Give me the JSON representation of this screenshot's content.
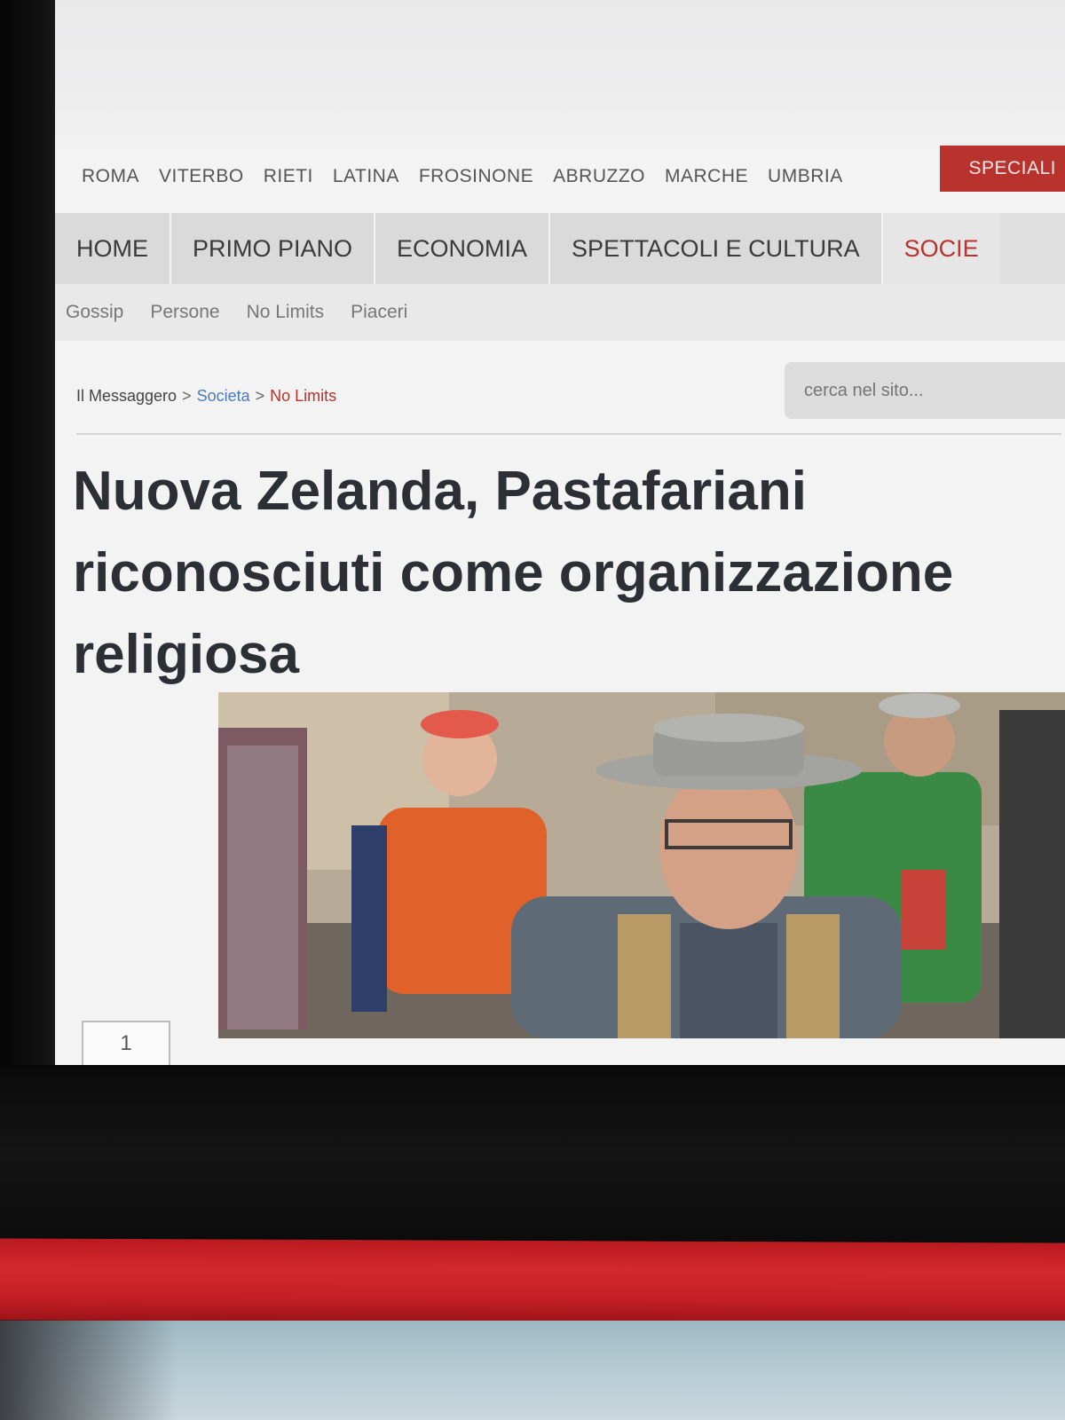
{
  "regions": [
    "ROMA",
    "VITERBO",
    "RIETI",
    "LATINA",
    "FROSINONE",
    "ABRUZZO",
    "MARCHE",
    "UMBRIA"
  ],
  "region_special": "SPECIALI",
  "main_nav": [
    "HOME",
    "PRIMO PIANO",
    "ECONOMIA",
    "SPETTACOLI E CULTURA"
  ],
  "main_nav_partial": "SOCIE",
  "sub_nav": [
    "Gossip",
    "Persone",
    "No Limits",
    "Piaceri"
  ],
  "breadcrumb": {
    "home": "Il Messaggero",
    "section": "Societa",
    "current": "No Limits",
    "separator": ">"
  },
  "search": {
    "placeholder": "cerca nel sito..."
  },
  "headline": "Nuova Zelanda, Pastafariani riconosciuti come organizzazione religiosa",
  "image_caption_page": "1",
  "colors": {
    "accent_red": "#b8322e",
    "link_blue": "#4a7bbf"
  }
}
